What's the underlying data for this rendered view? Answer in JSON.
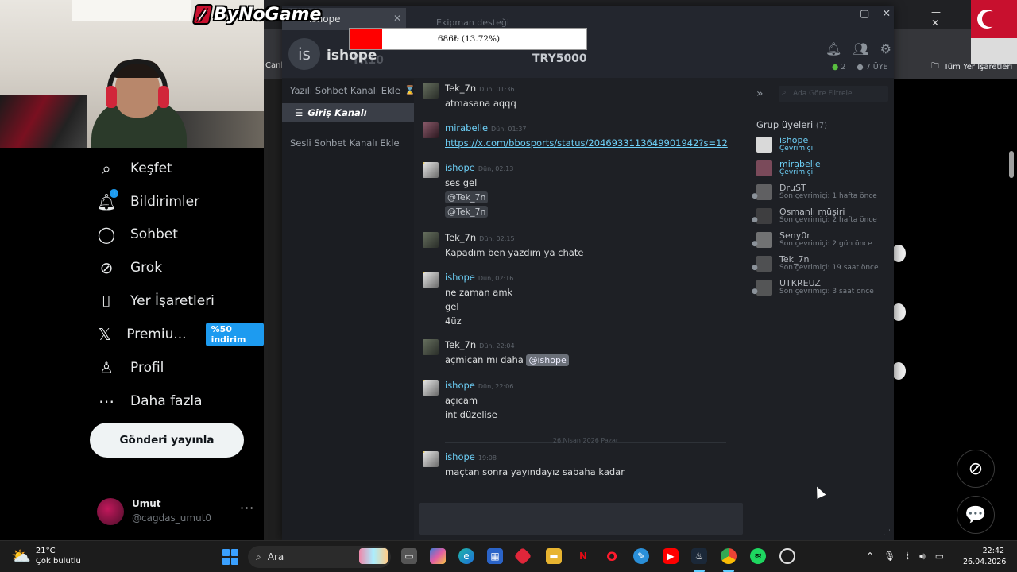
{
  "brand": {
    "text": "ByNoGame"
  },
  "x_sidebar": {
    "items": [
      {
        "label": "Keşfet",
        "icon": "search-icon"
      },
      {
        "label": "Bildirimler",
        "icon": "bell-icon",
        "badge": "1"
      },
      {
        "label": "Sohbet",
        "icon": "chat-bubble-icon"
      },
      {
        "label": "Grok",
        "icon": "grok-icon"
      },
      {
        "label": "Yer İşaretleri",
        "icon": "bookmark-icon"
      },
      {
        "label": "Premiu...",
        "icon": "x-logo-icon",
        "promo": "%50 indirim"
      },
      {
        "label": "Profil",
        "icon": "person-icon"
      },
      {
        "label": "Daha fazla",
        "icon": "more-circle-icon"
      }
    ],
    "post_button": "Gönderi yayınla",
    "account": {
      "name": "Umut",
      "handle": "@cagdas_umut0",
      "more": "···"
    }
  },
  "background_browser": {
    "tab_left_fragment": "Canlı",
    "bookmark": "Tüm Yer İşaretleri"
  },
  "steam": {
    "tab_title": "ishope",
    "group_name": "ishope",
    "group_avatar_text": "is",
    "overlay": {
      "left_ghost": "TR10",
      "right_ghost": "TRY5000",
      "top_ghost": "Ekipman desteği"
    },
    "donation": {
      "text": "686₺ (13.72%)",
      "progress_percent": 13.72
    },
    "header_counts": {
      "online": "2",
      "members": "7 ÜYE"
    },
    "channels": {
      "text_add": "Yazılı Sohbet Kanalı Ekle",
      "active": "Giriş Kanalı",
      "voice_add": "Sesli Sohbet Kanalı Ekle"
    },
    "messages": [
      {
        "author": "Tek_7n",
        "time": "Dün, 01:36",
        "lines": [
          "atmasana aqqq"
        ]
      },
      {
        "author": "mirabelle",
        "time": "Dün, 01:37",
        "link": "https://x.com/bbosports/status/2046933113649901942?s=12"
      },
      {
        "author": "ishope",
        "time": "Dün, 02:13",
        "lines": [
          "ses gel"
        ],
        "mentions": [
          "@Tek_7n",
          "@Tek_7n"
        ]
      },
      {
        "author": "Tek_7n",
        "time": "Dün, 02:15",
        "lines": [
          "Kapadım ben yazdım ya chate"
        ]
      },
      {
        "author": "ishope",
        "time": "Dün, 02:16",
        "lines": [
          "ne zaman amk",
          "gel",
          "4üz"
        ]
      },
      {
        "author": "Tek_7n",
        "time": "Dün, 22:04",
        "line_prefix": "açmican mı daha",
        "mention": "@ishope"
      },
      {
        "author": "ishope",
        "time": "Dün, 22:06",
        "lines": [
          "açıcam",
          "int düzelise"
        ]
      },
      {
        "author": "ishope",
        "time": "19:08",
        "lines": [
          "maçtan sonra yayındayız sabaha kadar"
        ]
      }
    ],
    "date_separator": "26 Nisan 2026 Pazar",
    "filter_placeholder": "Ada Göre Filtrele",
    "members_title": "Grup üyeleri",
    "members_count": "(7)",
    "members": [
      {
        "name": "ishope",
        "status": "Çevrimiçi",
        "online": true,
        "avatar_color": "#d9d9d9"
      },
      {
        "name": "mirabelle",
        "status": "Çevrimiçi",
        "online": true,
        "avatar_color": "#7a4a5a"
      },
      {
        "name": "DruST",
        "status": "Son çevrimiçi: 1 hafta önce",
        "online": false,
        "avatar_color": "#8a7a6a"
      },
      {
        "name": "Osmanlı müşiri",
        "status": "Son çevrimiçi: 2 hafta önce",
        "online": false,
        "avatar_color": "#5a4a3a"
      },
      {
        "name": "Seny0r",
        "status": "Son çevrimiçi: 2 gün önce",
        "online": false,
        "avatar_color": "#9a9a5a"
      },
      {
        "name": "Tek_7n",
        "status": "Son çevrimiçi: 19 saat önce",
        "online": false,
        "avatar_color": "#5a6a5a"
      },
      {
        "name": "UTKREUZ",
        "status": "Son çevrimiçi: 3 saat önce",
        "online": false,
        "avatar_color": "#6a6a8a"
      }
    ]
  },
  "taskbar": {
    "weather_temp": "21°C",
    "weather_desc": "Çok bulutlu",
    "search_label": "Ara",
    "time": "22:42",
    "date": "26.04.2026"
  }
}
